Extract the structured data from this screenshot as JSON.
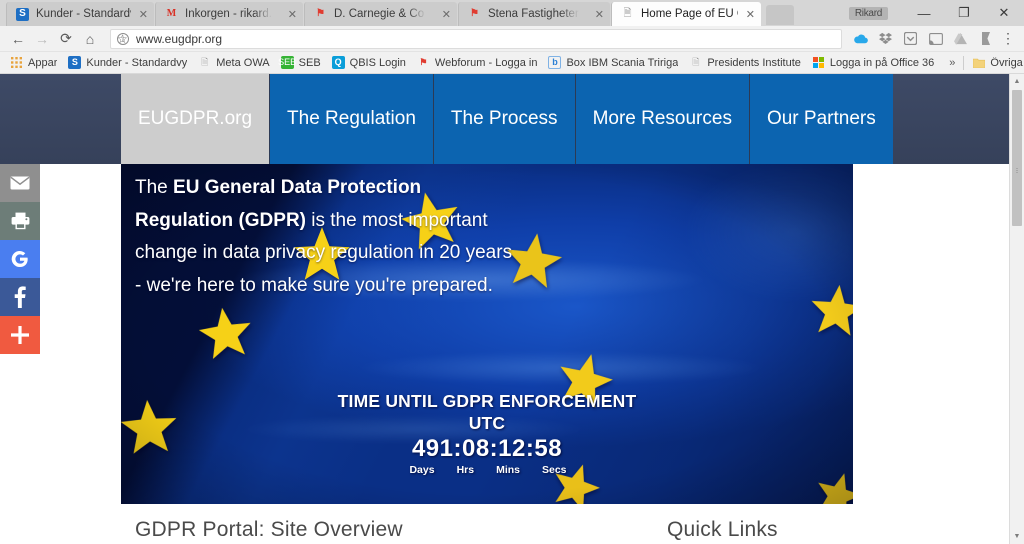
{
  "browser": {
    "tabs": [
      {
        "title": "Kunder - Standardvy",
        "favicon": "sharepoint-icon",
        "active": false
      },
      {
        "title": "Inkorgen - rikard.l.se@g",
        "favicon": "gmail-icon",
        "active": false
      },
      {
        "title": "D. Carnegie & Co Affärss",
        "favicon": "red-flag-icon",
        "active": false
      },
      {
        "title": "Stena Fastigheter Fastigh",
        "favicon": "red-flag-icon",
        "active": false
      },
      {
        "title": "Home Page of EU GDPR",
        "favicon": "document-icon",
        "active": true
      }
    ],
    "new_tab_label": "+",
    "profile_name": "Rikard",
    "window_controls": {
      "minimize": "—",
      "maximize": "❐",
      "close": "✕"
    },
    "toolbar": {
      "back": "←",
      "forward": "→",
      "reload": "⟳",
      "home": "⌂",
      "url": "www.eugdpr.org",
      "site_info_icon": "info-icon",
      "bookmark_star": "☆",
      "menu": "⋮",
      "extensions": [
        "onedrive-icon",
        "dropbox-icon",
        "pocket-icon",
        "cast-icon",
        "drive-icon",
        "flag-icon"
      ]
    },
    "bookmarks": [
      {
        "label": "Appar",
        "icon": "apps-grid-icon",
        "style": "fav-grid",
        "glyph": "∷"
      },
      {
        "label": "Kunder - Standardvy",
        "icon": "sharepoint-icon",
        "style": "fav-sp",
        "glyph": "S"
      },
      {
        "label": "Meta OWA",
        "icon": "document-icon",
        "style": "fav-doc",
        "glyph": "❐"
      },
      {
        "label": "SEB",
        "icon": "seb-icon",
        "style": "fav-green",
        "glyph": "SEB"
      },
      {
        "label": "QBIS Login",
        "icon": "qbis-icon",
        "style": "fav-qbis",
        "glyph": "Q"
      },
      {
        "label": "Webforum - Logga in",
        "icon": "red-flag-icon",
        "style": "fav-red",
        "glyph": "⚑"
      },
      {
        "label": "Box IBM Scania Tririga",
        "icon": "box-icon",
        "style": "fav-box",
        "glyph": "b"
      },
      {
        "label": "Presidents Institute",
        "icon": "document-icon",
        "style": "fav-doc",
        "glyph": "❐"
      },
      {
        "label": "Logga in på Office 36",
        "icon": "microsoft-icon",
        "style": "fav-ms",
        "glyph": "◰"
      }
    ],
    "bookmarks_overflow": "»",
    "other_bookmarks": {
      "label": "Övriga bokmärken",
      "icon": "folder-icon"
    }
  },
  "site": {
    "nav": [
      {
        "label": "EUGDPR.org",
        "active": true
      },
      {
        "label": "The Regulation",
        "active": false
      },
      {
        "label": "The Process",
        "active": false
      },
      {
        "label": "More Resources",
        "active": false
      },
      {
        "label": "Our Partners",
        "active": false
      }
    ],
    "hero": {
      "text_before": "The ",
      "text_bold": "EU General Data Protection Regulation (GDPR)",
      "text_after": " is the most important change in data privacy regulation in 20 years - we're here to make sure you're prepared."
    },
    "countdown": {
      "title_line1": "TIME UNTIL GDPR ENFORCEMENT",
      "title_line2": "UTC",
      "clock": "491:08:12:58",
      "unit_days": "Days",
      "unit_hrs": "Hrs",
      "unit_mins": "Mins",
      "unit_secs": "Secs"
    },
    "sections": {
      "main_heading": "GDPR Portal: Site Overview",
      "side_heading": "Quick Links"
    },
    "share_rail": [
      {
        "name": "email-share-button",
        "icon": "envelope-icon",
        "color": "#8f8f8f"
      },
      {
        "name": "print-share-button",
        "icon": "printer-icon",
        "color": "#6d7d78"
      },
      {
        "name": "google-share-button",
        "icon": "google-icon",
        "color": "#4a7ef0"
      },
      {
        "name": "facebook-share-button",
        "icon": "facebook-icon",
        "color": "#3b5998"
      },
      {
        "name": "more-share-button",
        "icon": "plus-icon",
        "color": "#f05a40"
      }
    ]
  },
  "colors": {
    "nav_bar": "#3a4560",
    "nav_item": "#0c64b0",
    "brand_tab": "#cdcdcd",
    "flag_blue": "#0b3a9a",
    "star_yellow": "#f6d117"
  }
}
